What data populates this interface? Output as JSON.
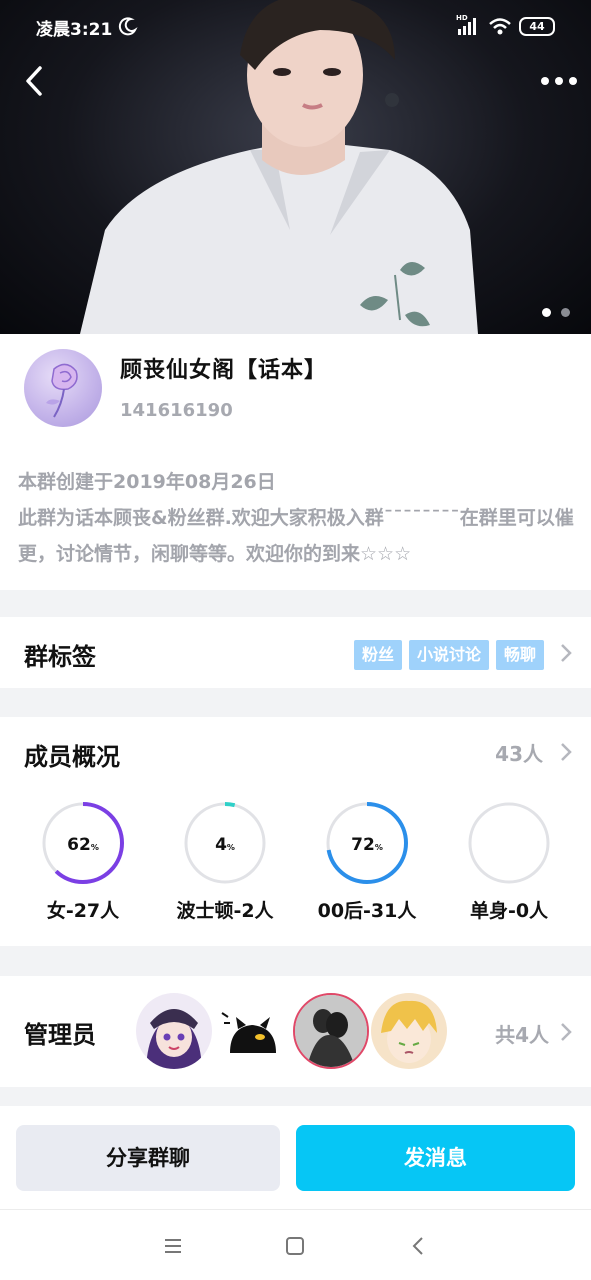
{
  "status_bar": {
    "time": "凌晨3:21",
    "network": "HD",
    "battery": "44"
  },
  "hero": {
    "page_count": 2,
    "active_page": 0
  },
  "group": {
    "name": "顾丧仙女阁【话本】",
    "id": "141616190",
    "description_line1": "本群创建于2019年08月26日",
    "description_body": "此群为话本顾丧&粉丝群.欢迎大家积极入群¯¯¯¯¯¯¯¯在群里可以催更，讨论情节，闲聊等等。欢迎你的到来☆☆☆"
  },
  "tags_section": {
    "title": "群标签",
    "tags": [
      "粉丝",
      "小说讨论",
      "畅聊"
    ]
  },
  "members_section": {
    "title": "成员概况",
    "count": "43人",
    "stats": [
      {
        "percent": "62",
        "unit": "%",
        "label": "女-27人",
        "fraction": 0.62,
        "color": "#7b3fe4"
      },
      {
        "percent": "4",
        "unit": "%",
        "label": "波士顿-2人",
        "fraction": 0.04,
        "color": "#2fd0c8"
      },
      {
        "percent": "72",
        "unit": "%",
        "label": "00后-31人",
        "fraction": 0.72,
        "color": "#2b8fea"
      },
      {
        "percent": "",
        "unit": "",
        "label": "单身-0人",
        "fraction": 0,
        "color": "#2b8fea"
      }
    ]
  },
  "admins_section": {
    "title": "管理员",
    "count": "共4人"
  },
  "actions": {
    "share_label": "分享群聊",
    "send_label": "发消息"
  },
  "colors": {
    "accent": "#06c6f5",
    "tag_bg": "#9fd2fb",
    "muted_text": "#a7a9b0"
  }
}
